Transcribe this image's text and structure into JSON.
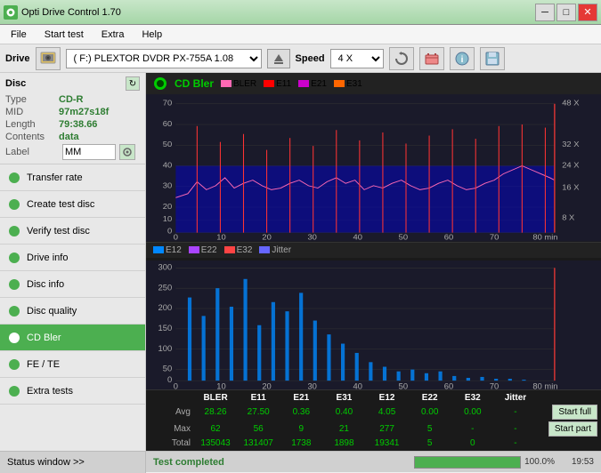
{
  "titlebar": {
    "title": "Opti Drive Control 1.70",
    "min_label": "─",
    "max_label": "□",
    "close_label": "✕"
  },
  "menubar": {
    "items": [
      "File",
      "Start test",
      "Extra",
      "Help"
    ]
  },
  "drivebar": {
    "drive_label": "Drive",
    "drive_value": "(F:)  PLEXTOR DVDR  PX-755A 1.08",
    "speed_label": "Speed",
    "speed_value": "4 X"
  },
  "disc": {
    "title": "Disc",
    "type_label": "Type",
    "type_value": "CD-R",
    "mid_label": "MID",
    "mid_value": "97m27s18f",
    "length_label": "Length",
    "length_value": "79:38.66",
    "contents_label": "Contents",
    "contents_value": "data",
    "label_label": "Label",
    "label_value": "MM"
  },
  "sidebar": {
    "items": [
      {
        "id": "transfer-rate",
        "label": "Transfer rate",
        "active": false
      },
      {
        "id": "create-test-disc",
        "label": "Create test disc",
        "active": false
      },
      {
        "id": "verify-test-disc",
        "label": "Verify test disc",
        "active": false
      },
      {
        "id": "drive-info",
        "label": "Drive info",
        "active": false
      },
      {
        "id": "disc-info",
        "label": "Disc info",
        "active": false
      },
      {
        "id": "disc-quality",
        "label": "Disc quality",
        "active": false
      },
      {
        "id": "cd-bler",
        "label": "CD Bler",
        "active": true
      },
      {
        "id": "fe-te",
        "label": "FE / TE",
        "active": false
      },
      {
        "id": "extra-tests",
        "label": "Extra tests",
        "active": false
      }
    ]
  },
  "chart": {
    "title": "CD Bler",
    "top": {
      "legend": [
        {
          "label": "BLER",
          "color": "#ff69b4"
        },
        {
          "label": "E11",
          "color": "#ff0000"
        },
        {
          "label": "E21",
          "color": "#cc00cc"
        },
        {
          "label": "E31",
          "color": "#ff6600"
        }
      ],
      "y_max": 70,
      "y_labels": [
        "70",
        "60",
        "50",
        "40",
        "30",
        "20",
        "10",
        "0"
      ],
      "x_labels": [
        "0",
        "10",
        "20",
        "30",
        "40",
        "50",
        "60",
        "70",
        "80 min"
      ],
      "right_labels": [
        "48 X",
        "32 X",
        "24 X",
        "16 X",
        "8 X"
      ]
    },
    "bottom": {
      "legend": [
        {
          "label": "E12",
          "color": "#00aaff"
        },
        {
          "label": "E22",
          "color": "#aa00ff"
        },
        {
          "label": "E32",
          "color": "#ff4444"
        },
        {
          "label": "Jitter",
          "color": "#6666ff"
        }
      ],
      "y_max": 300,
      "y_labels": [
        "300",
        "250",
        "200",
        "150",
        "100",
        "50",
        "0"
      ],
      "x_labels": [
        "0",
        "10",
        "20",
        "30",
        "40",
        "50",
        "60",
        "70",
        "80 min"
      ]
    }
  },
  "table": {
    "columns": [
      "",
      "BLER",
      "E11",
      "E21",
      "E31",
      "E12",
      "E22",
      "E32",
      "Jitter",
      ""
    ],
    "rows": [
      {
        "label": "Avg",
        "values": [
          "28.26",
          "27.50",
          "0.36",
          "0.40",
          "4.05",
          "0.00",
          "0.00",
          "-"
        ]
      },
      {
        "label": "Max",
        "values": [
          "62",
          "56",
          "9",
          "21",
          "277",
          "5",
          "-",
          "-"
        ]
      },
      {
        "label": "Total",
        "values": [
          "135043",
          "131407",
          "1738",
          "1898",
          "19341",
          "5",
          "0",
          "-"
        ]
      }
    ],
    "btn_start_full": "Start full",
    "btn_start_part": "Start part"
  },
  "statusbar": {
    "window_btn_label": "Status window >>",
    "status_text": "Test completed",
    "progress_pct": 100,
    "progress_label": "100.0%",
    "time_label": "19:53"
  }
}
